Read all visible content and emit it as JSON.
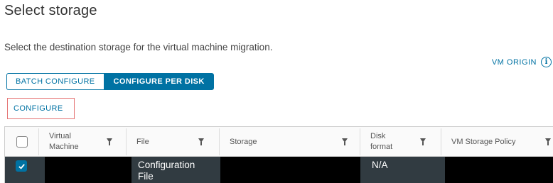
{
  "page": {
    "title": "Select storage",
    "description": "Select the destination storage for the virtual machine migration."
  },
  "vm_origin": {
    "label": "VM ORIGIN",
    "icon": "info-icon"
  },
  "toggle": {
    "batch_label": "BATCH CONFIGURE",
    "per_disk_label": "CONFIGURE PER DISK",
    "selected": "CONFIGURE PER DISK"
  },
  "configure_label": "CONFIGURE",
  "table": {
    "columns": [
      "Virtual Machine",
      "File",
      "Storage",
      "Disk format",
      "VM Storage Policy"
    ],
    "rows": [
      {
        "checked": true,
        "virtual_machine": "",
        "file": "Configuration File",
        "storage": "",
        "disk_format": "N/A",
        "vm_storage_policy": ""
      }
    ]
  },
  "colors": {
    "accent": "#0072a3",
    "highlight_border": "#e57373",
    "row_bg": "#313b41"
  }
}
